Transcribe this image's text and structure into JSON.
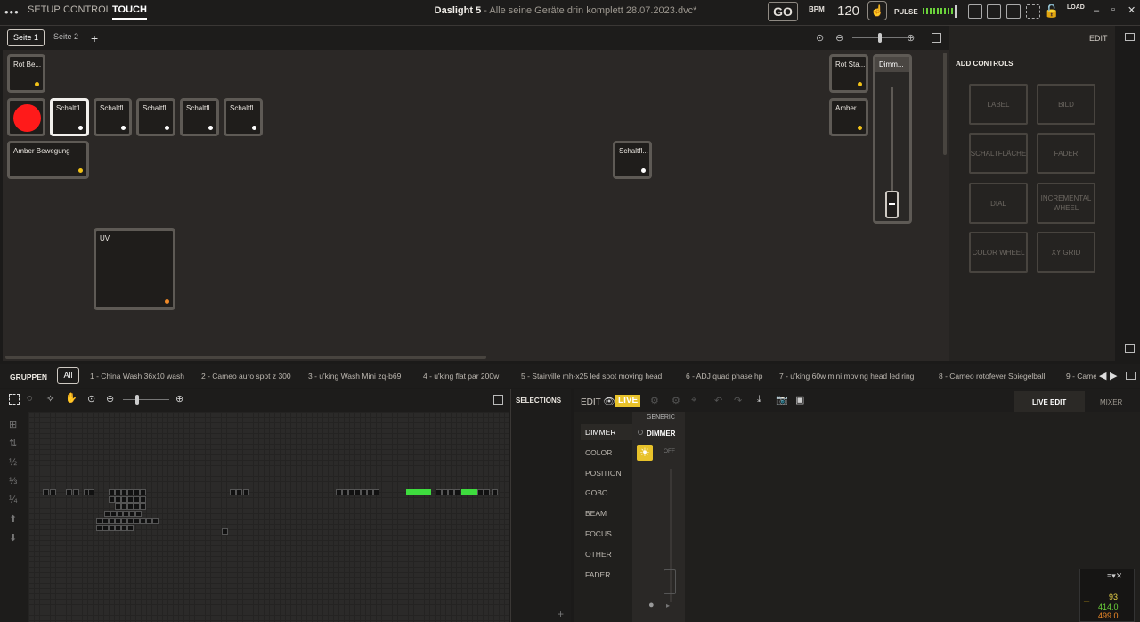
{
  "header": {
    "menu": "•••",
    "tabs": [
      "SETUP",
      "CONTROL",
      "TOUCH"
    ],
    "app": "Daslight 5",
    "file": " - Alle seine Geräte drin komplett 28.07.2023.dvc*",
    "go": "GO",
    "bpm_label": "BPM",
    "bpm": "120",
    "pulse_label": "PULSE",
    "load_label": "LOAD"
  },
  "pages": {
    "tabs": [
      "Seite 1",
      "Seite 2"
    ],
    "add": "+"
  },
  "controls": [
    {
      "label": "Rot Be...",
      "dot": "#f2c218"
    },
    {
      "label": "Schaltfl...",
      "dot": "#ffffff"
    },
    {
      "label": "Schaltfl...",
      "dot": "#ffffff"
    },
    {
      "label": "Schaltfl...",
      "dot": "#ffffff"
    },
    {
      "label": "Schaltfl...",
      "dot": "#ffffff"
    },
    {
      "label": "Schaltfl...",
      "dot": "#ffffff"
    },
    {
      "label": "Amber Bewegung",
      "dot": "#f2c218"
    },
    {
      "label": "UV",
      "dot": "#f08a28"
    },
    {
      "label": "Schaltfl...",
      "dot": "#ffffff"
    },
    {
      "label": "Rot Sta...",
      "dot": "#f2c218"
    },
    {
      "label": "Amber",
      "dot": "#f2c218"
    },
    {
      "label": "Dimm..."
    }
  ],
  "red_button": "#ff1a1a",
  "edit_panel": {
    "edit": "EDIT",
    "add_controls": "ADD CONTROLS",
    "buttons": [
      "LABEL",
      "BILD",
      "SCHALTFLÄCHE",
      "FADER",
      "DIAL",
      "INCREMENTAL WHEEL",
      "COLOR WHEEL",
      "XY GRID"
    ]
  },
  "groups": {
    "label": "GRUPPEN",
    "all": "All",
    "items": [
      "1 - China Wash 36x10 wash",
      "2 - Cameo auro spot z 300",
      "3 - u'king Wash Mini  zq-b69",
      "4 - u'king flat par 200w",
      "5 - Stairville mh-x25 led spot moving head",
      "6 - ADJ quad phase hp",
      "7 - u'king 60w mini moving head led ring",
      "8 - Cameo rotofever Spiegelball",
      "9 - Came"
    ]
  },
  "selections": {
    "title": "SELECTIONS",
    "add": "+"
  },
  "live": {
    "edit": "EDIT",
    "live": "LIVE",
    "categories": [
      "DIMMER",
      "COLOR",
      "POSITION",
      "GOBO",
      "BEAM",
      "FOCUS",
      "OTHER",
      "FADER"
    ],
    "generic": "GENERIC",
    "dimmer": "DIMMER",
    "off": "OFF",
    "tabs": [
      "LIVE EDIT",
      "MIXER"
    ]
  },
  "perf": {
    "v1": "93",
    "v2": "414.0",
    "v3": "499.0"
  }
}
